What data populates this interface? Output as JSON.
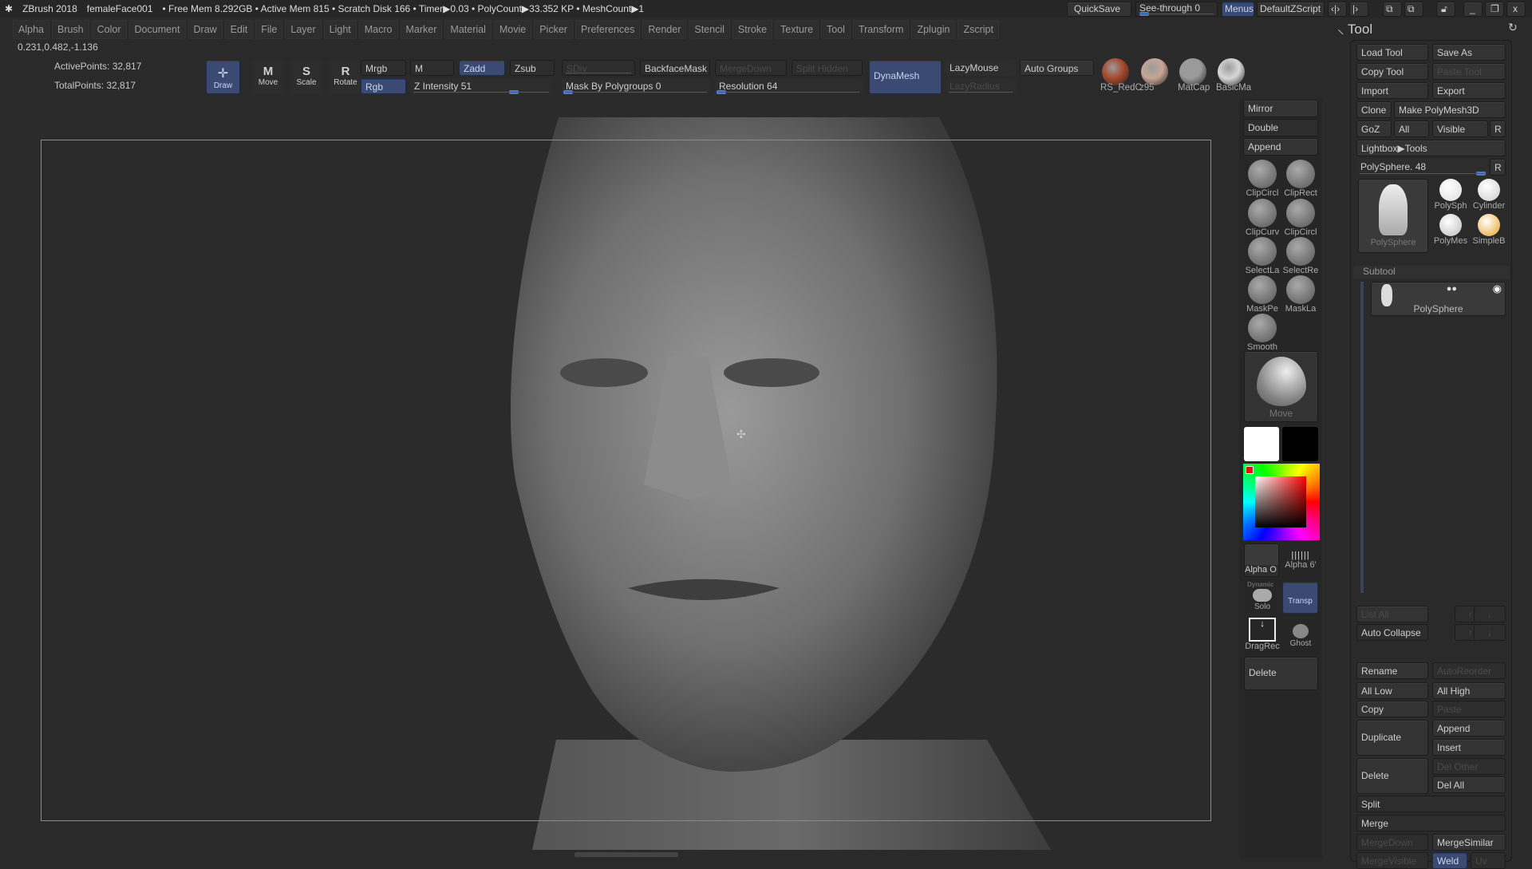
{
  "title": {
    "app": "ZBrush 2018",
    "file": "femaleFace001",
    "stats": "• Free Mem 8.292GB • Active Mem 815 • Scratch Disk 166 • Timer▶0.03 • PolyCount▶33.352 KP • MeshCount▶1"
  },
  "titlebar_right": {
    "quicksave": "QuickSave",
    "seethrough": "See-through  0",
    "menus": "Menus",
    "script": "DefaultZScript"
  },
  "menus": [
    "Alpha",
    "Brush",
    "Color",
    "Document",
    "Draw",
    "Edit",
    "File",
    "Layer",
    "Light",
    "Macro",
    "Marker",
    "Material",
    "Movie",
    "Picker",
    "Preferences",
    "Render",
    "Stencil",
    "Stroke",
    "Texture",
    "Tool",
    "Transform",
    "Zplugin",
    "Zscript"
  ],
  "coords": "0.231,0.482,-1.136",
  "info": {
    "active": "ActivePoints: 32,817",
    "total": "TotalPoints: 32,817"
  },
  "toolbar": {
    "draw": "Draw",
    "move": "Move",
    "scale": "Scale",
    "rotate": "Rotate",
    "mrgb": "Mrgb",
    "rgb": "Rgb",
    "m": "M",
    "zadd": "Zadd",
    "zsub": "Zsub",
    "sdiv": "SDiv",
    "backface": "BackfaceMask",
    "mergedown": "MergeDown",
    "splithidden": "Split Hidden",
    "dynamesh": "DynaMesh",
    "lazymouse": "LazyMouse",
    "lazyradius": "LazyRadius",
    "autogroups": "Auto Groups",
    "zintensity": "Z Intensity 51",
    "maskpoly": "Mask By Polygroups 0",
    "resolution": "Resolution 64"
  },
  "slider_values": {
    "z_intensity": 51,
    "mask_by_polygroups": 0,
    "resolution": 64,
    "see_through": 0,
    "polysphere": 48
  },
  "materials": [
    {
      "label": "RS_RedC",
      "color": "#a4482a"
    },
    {
      "label": "z95",
      "color": "#c9a594"
    },
    {
      "label": "MatCap",
      "color": "#9a9a9a"
    },
    {
      "label": "BasicMa",
      "color": "#d8d8d8"
    }
  ],
  "shelf": {
    "mirror": "Mirror",
    "double": "Double",
    "append": "Append",
    "tools": [
      "ClipCircl",
      "ClipRect",
      "ClipCurv",
      "ClipCircl",
      "SelectLa",
      "SelectRe",
      "MaskPe",
      "MaskLa",
      "Smooth"
    ],
    "brush": "Move",
    "alpha": "Alpha O",
    "alpha2": "Alpha 6'",
    "dynamic": "Dynamic",
    "solo": "Solo",
    "transp": "Transp",
    "dragrect": "DragRec",
    "ghost": "Ghost",
    "delete": "Delete"
  },
  "tool": {
    "title": "Tool",
    "load": "Load Tool",
    "saveas": "Save As",
    "copy": "Copy Tool",
    "paste": "Paste Tool",
    "import": "Import",
    "export": "Export",
    "clone": "Clone",
    "makepoly": "Make PolyMesh3D",
    "goz": "GoZ",
    "all": "All",
    "visible": "Visible",
    "r": "R",
    "lightbox": "Lightbox▶Tools",
    "polysphere": "PolySphere. 48",
    "thumbs": [
      "PolySphere",
      "PolySph",
      "Cylinder",
      "PolyMes",
      "SimpleB"
    ]
  },
  "subtool": {
    "header": "Subtool",
    "item": "PolySphere",
    "listall": "List All",
    "autocollapse": "Auto Collapse",
    "rename": "Rename",
    "autoreorder": "AutoReorder",
    "alllow": "All Low",
    "allhigh": "All High",
    "copy": "Copy",
    "paste": "Paste",
    "duplicate": "Duplicate",
    "append": "Append",
    "insert": "Insert",
    "delete": "Delete",
    "delother": "Del Other",
    "delall": "Del All",
    "split": "Split",
    "merge": "Merge",
    "mergedown": "MergeDown",
    "mergesimilar": "MergeSimilar",
    "mergevisible": "MergeVisible",
    "weld": "Weld",
    "uv": "Uv"
  },
  "colors": {
    "accent": "#3a4a72",
    "primary_color": "#ffffff",
    "secondary_color": "#000000"
  }
}
